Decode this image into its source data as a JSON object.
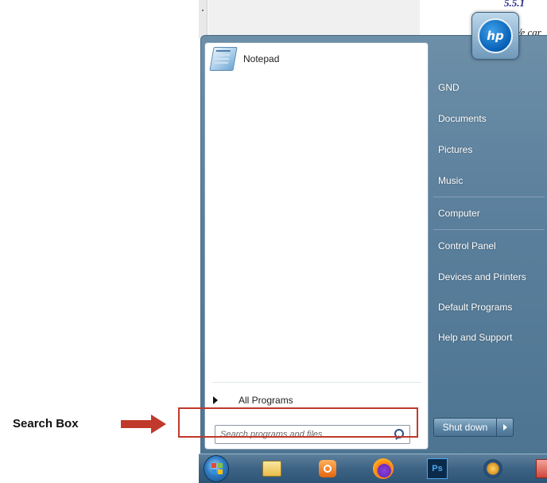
{
  "background_doc": {
    "text_top": "5.5.1",
    "text_side": "Ve car"
  },
  "start_menu": {
    "pinned_programs": [
      {
        "label": "Notepad",
        "icon": "notepad-icon"
      }
    ],
    "all_programs_label": "All Programs",
    "search": {
      "placeholder": "Search programs and files",
      "icon": "search-icon"
    },
    "user_picture": {
      "icon": "hp-logo-icon",
      "text": "hp"
    },
    "right_links": [
      {
        "label": "GND"
      },
      {
        "label": "Documents"
      },
      {
        "label": "Pictures"
      },
      {
        "label": "Music"
      },
      {
        "label": "Computer"
      },
      {
        "label": "Control Panel"
      },
      {
        "label": "Devices and Printers"
      },
      {
        "label": "Default Programs"
      },
      {
        "label": "Help and Support"
      }
    ],
    "shutdown_label": "Shut down"
  },
  "annotation": {
    "label": "Search Box",
    "color": "#c0392b"
  },
  "taskbar": {
    "items": [
      {
        "icon": "start-orb-icon"
      },
      {
        "icon": "explorer-icon"
      },
      {
        "icon": "media-player-icon"
      },
      {
        "icon": "firefox-icon"
      },
      {
        "icon": "photoshop-icon",
        "text": "Ps"
      },
      {
        "icon": "app-icon"
      },
      {
        "icon": "partial-icon"
      }
    ]
  }
}
